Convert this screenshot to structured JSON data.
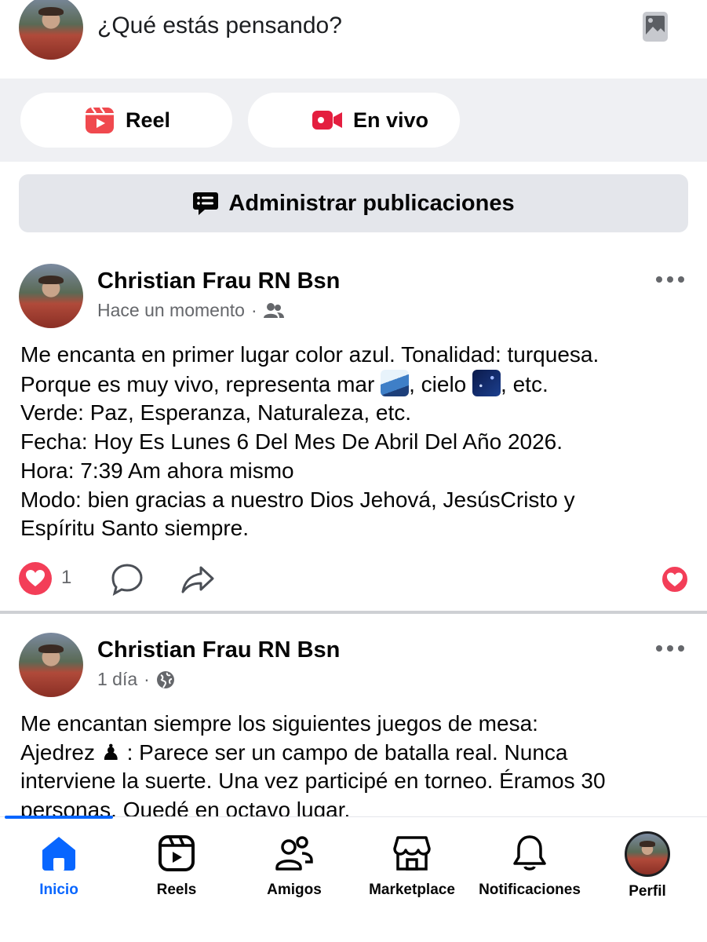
{
  "composer": {
    "placeholder": "¿Qué estás pensando?"
  },
  "quick_actions": [
    {
      "label": "Reel",
      "icon": "reel-icon",
      "color": "#f0494e"
    },
    {
      "label": "En vivo",
      "icon": "live-video-icon",
      "color": "#e41e3f"
    }
  ],
  "manage_button": {
    "label": "Administrar publicaciones",
    "icon": "manage-posts-icon"
  },
  "posts": [
    {
      "author": "Christian Frau RN Bsn",
      "time": "Hace un momento",
      "audience_icon": "friends-audience-icon",
      "lines": [
        "Me encanta en primer lugar color azul. Tonalidad: turquesa.",
        "Porque es muy vivo, representa mar",
        ", cielo",
        ", etc.",
        "Verde: Paz, Esperanza, Naturaleza, etc.",
        "Fecha: Hoy Es Lunes 6 Del Mes De Abril Del Año 2026.",
        "Hora: 7:39 Am ahora mismo",
        "Modo: bien gracias a nuestro Dios Jehová, JesúsCristo y",
        "Espíritu Santo siempre."
      ],
      "likes": "1"
    },
    {
      "author": "Christian Frau RN Bsn",
      "time": "1 día",
      "audience_icon": "public-globe-icon",
      "lines": [
        "Me encantan siempre los siguientes juegos de mesa:",
        "Ajedrez",
        ": Parece ser un campo de batalla real. Nunca",
        "interviene la suerte. Una vez participé en torneo. Éramos 30",
        "personas. Quedé en octavo lugar."
      ]
    }
  ],
  "bottom_nav": [
    {
      "label": "Inicio",
      "icon": "home-icon",
      "active": true
    },
    {
      "label": "Reels",
      "icon": "reels-icon"
    },
    {
      "label": "Amigos",
      "icon": "friends-icon"
    },
    {
      "label": "Marketplace",
      "icon": "marketplace-icon"
    },
    {
      "label": "Notificaciones",
      "icon": "bell-icon"
    },
    {
      "label": "Perfil",
      "icon": "profile-avatar"
    }
  ],
  "colors": {
    "accent": "#0866ff",
    "like": "#f33e58",
    "background_band": "#eff0f3"
  }
}
